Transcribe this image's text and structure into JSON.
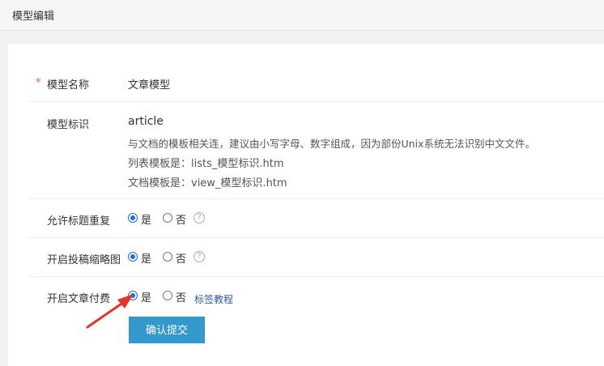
{
  "header": {
    "title": "模型编辑"
  },
  "form": {
    "model_name": {
      "required_mark": "*",
      "label": "模型名称",
      "value": "文章模型"
    },
    "model_id": {
      "label": "模型标识",
      "value": "article",
      "hint": "与文档的模板相关连，建议由小写字母、数字组成，因为部份Unix系统无法识别中文文件。",
      "list_template": "列表模板是：lists_模型标识.htm",
      "doc_template": "文档模板是：view_模型标识.htm"
    },
    "allow_dup_title": {
      "label": "允许标题重复",
      "yes": "是",
      "no": "否",
      "selected": "是",
      "help": "?"
    },
    "submission_thumb": {
      "label": "开启投稿缩略图",
      "yes": "是",
      "no": "否",
      "selected": "是",
      "help": "?"
    },
    "article_paid": {
      "label": "开启文章付费",
      "yes": "是",
      "no": "否",
      "selected": "是",
      "link": "标签教程"
    },
    "submit_label": "确认提交"
  },
  "colors": {
    "accent": "#3398cc",
    "radio": "#1e6fd9",
    "required": "#ff5722",
    "annotation_arrow": "#e8332a"
  }
}
